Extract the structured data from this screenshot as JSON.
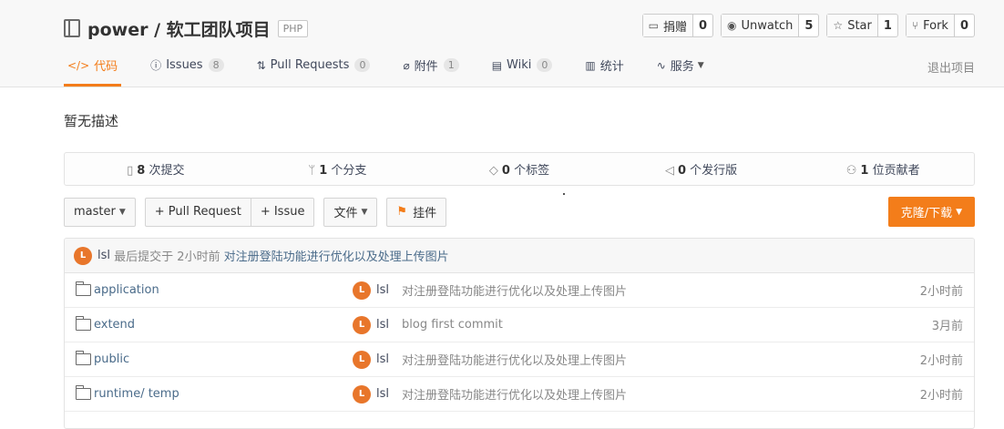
{
  "repo": {
    "title": "power / 软工团队项目",
    "lang": "PHP"
  },
  "actions": [
    {
      "icon": "donate-icon",
      "label": "捐赠",
      "count": "0"
    },
    {
      "icon": "eye-icon",
      "label": "Unwatch",
      "count": "5"
    },
    {
      "icon": "star-icon",
      "label": "Star",
      "count": "1"
    },
    {
      "icon": "fork-icon",
      "label": "Fork",
      "count": "0"
    }
  ],
  "tabs": [
    {
      "icon": "code-icon",
      "label": "代码",
      "badge": ""
    },
    {
      "icon": "info-icon",
      "label": "Issues",
      "badge": "8"
    },
    {
      "icon": "pull-request-icon",
      "label": "Pull Requests",
      "badge": "0"
    },
    {
      "icon": "paperclip-icon",
      "label": "附件",
      "badge": "1"
    },
    {
      "icon": "book-icon",
      "label": "Wiki",
      "badge": "0"
    },
    {
      "icon": "chart-icon",
      "label": "统计",
      "badge": ""
    },
    {
      "icon": "pulse-icon",
      "label": "服务",
      "badge": ""
    }
  ],
  "exit_label": "退出项目",
  "description": "暂无描述",
  "stats": [
    {
      "icon": "commit-icon",
      "count": "8",
      "label": "次提交"
    },
    {
      "icon": "branch-icon",
      "count": "1",
      "label": "个分支"
    },
    {
      "icon": "tag-icon",
      "count": "0",
      "label": "个标签"
    },
    {
      "icon": "release-icon",
      "count": "0",
      "label": "个发行版"
    },
    {
      "icon": "contributors-icon",
      "count": "1",
      "label": "位贡献者"
    }
  ],
  "toolbar": {
    "branch": "master",
    "pull_request": "+ Pull Request",
    "issue": "+ Issue",
    "file": "文件",
    "widget": "挂件",
    "clone": "克隆/下载"
  },
  "last_commit": {
    "avatar": "L",
    "author": "lsl",
    "prefix": "最后提交于",
    "time": "2小时前",
    "message": "对注册登陆功能进行优化以及处理上传图片"
  },
  "files": [
    {
      "name": "application",
      "avatar": "L",
      "author": "lsl",
      "message": "对注册登陆功能进行优化以及处理上传图片",
      "time": "2小时前"
    },
    {
      "name": "extend",
      "avatar": "L",
      "author": "lsl",
      "message": "blog first commit",
      "time": "3月前"
    },
    {
      "name": "public",
      "avatar": "L",
      "author": "lsl",
      "message": "对注册登陆功能进行优化以及处理上传图片",
      "time": "2小时前"
    },
    {
      "name": "runtime/ temp",
      "avatar": "L",
      "author": "lsl",
      "message": "对注册登陆功能进行优化以及处理上传图片",
      "time": "2小时前"
    }
  ],
  "colors": {
    "accent": "#f37d1a",
    "avatar": "#e8762b",
    "link": "#4a6b8a"
  }
}
